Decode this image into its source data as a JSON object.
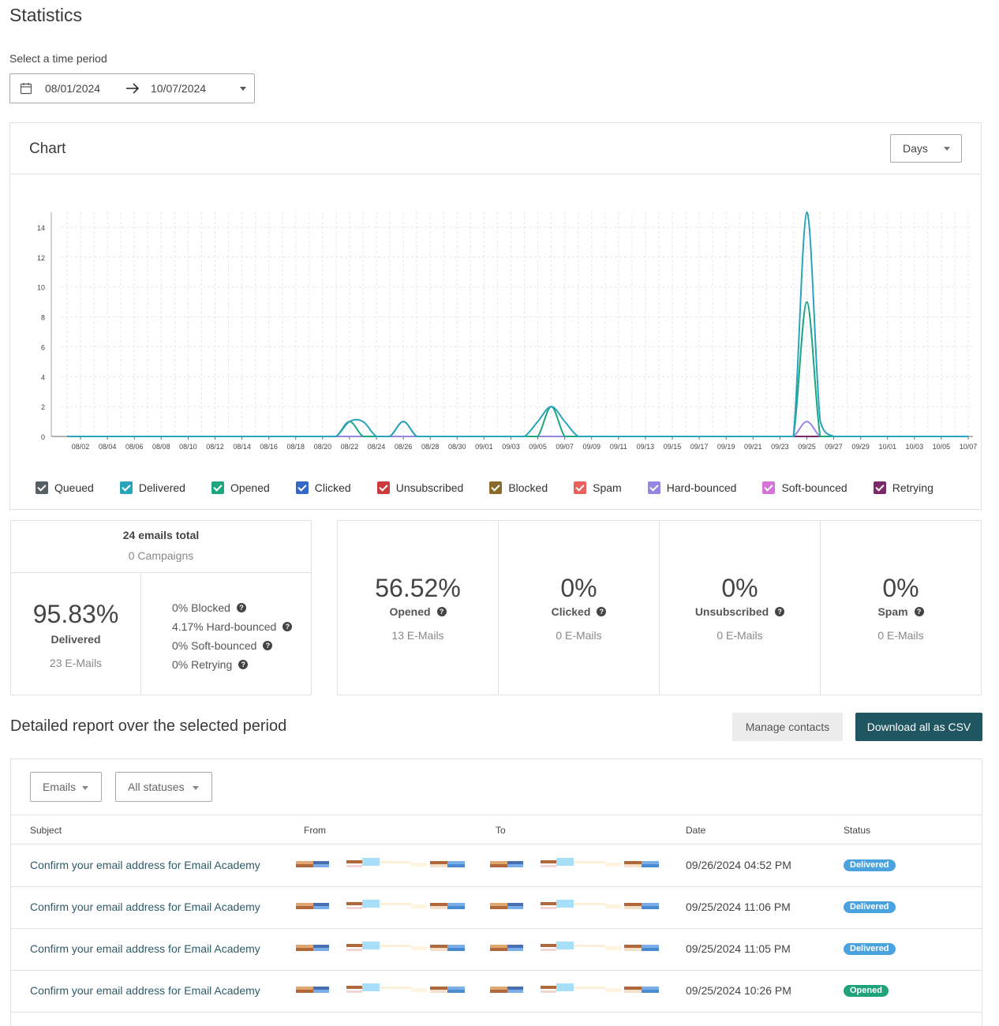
{
  "page": {
    "title": "Statistics"
  },
  "period": {
    "label": "Select a time period",
    "start": "08/01/2024",
    "end": "10/07/2024"
  },
  "chart_card": {
    "title": "Chart",
    "granularity": "Days"
  },
  "chart_data": {
    "type": "line",
    "x": [
      "08/01",
      "08/02",
      "08/03",
      "08/04",
      "08/05",
      "08/06",
      "08/07",
      "08/08",
      "08/09",
      "08/10",
      "08/11",
      "08/12",
      "08/13",
      "08/14",
      "08/15",
      "08/16",
      "08/17",
      "08/18",
      "08/19",
      "08/20",
      "08/21",
      "08/22",
      "08/23",
      "08/24",
      "08/25",
      "08/26",
      "08/27",
      "08/28",
      "08/29",
      "08/30",
      "08/31",
      "09/01",
      "09/02",
      "09/03",
      "09/04",
      "09/05",
      "09/06",
      "09/07",
      "09/08",
      "09/09",
      "09/10",
      "09/11",
      "09/12",
      "09/13",
      "09/14",
      "09/15",
      "09/16",
      "09/17",
      "09/18",
      "09/19",
      "09/20",
      "09/21",
      "09/22",
      "09/23",
      "09/24",
      "09/25",
      "09/26",
      "09/27",
      "09/28",
      "09/29",
      "09/30",
      "10/01",
      "10/02",
      "10/03",
      "10/04",
      "10/05",
      "10/06",
      "10/07"
    ],
    "tick_labels": [
      "08/02",
      "08/04",
      "08/06",
      "08/08",
      "08/10",
      "08/12",
      "08/14",
      "08/16",
      "08/18",
      "08/20",
      "08/22",
      "08/24",
      "08/26",
      "08/28",
      "08/30",
      "09/01",
      "09/03",
      "09/05",
      "09/07",
      "09/09",
      "09/11",
      "09/13",
      "09/15",
      "09/17",
      "09/19",
      "09/21",
      "09/23",
      "09/25",
      "09/27",
      "09/29",
      "10/01",
      "10/03",
      "10/05",
      "10/07"
    ],
    "y_ticks": [
      0,
      2,
      4,
      6,
      8,
      10,
      12,
      14
    ],
    "ylim": [
      0,
      15
    ],
    "grid": true,
    "legend_position": "bottom",
    "series": [
      {
        "name": "Queued",
        "color": "#555f66",
        "points": {}
      },
      {
        "name": "Delivered",
        "color": "#2aa3bd",
        "points": {
          "08/22": 1,
          "08/23": 1,
          "08/26": 1,
          "09/05": 1,
          "09/06": 2,
          "09/07": 1,
          "09/25": 15,
          "09/26": 1
        }
      },
      {
        "name": "Opened",
        "color": "#1ea680",
        "points": {
          "08/22": 1,
          "08/26": 1,
          "09/06": 2,
          "09/25": 9
        }
      },
      {
        "name": "Clicked",
        "color": "#3368c7",
        "points": {}
      },
      {
        "name": "Unsubscribed",
        "color": "#cc3b3b",
        "points": {}
      },
      {
        "name": "Blocked",
        "color": "#8a6a2a",
        "points": {}
      },
      {
        "name": "Spam",
        "color": "#eb5f5f",
        "points": {}
      },
      {
        "name": "Hard-bounced",
        "color": "#9586e3",
        "points": {
          "09/25": 1
        }
      },
      {
        "name": "Soft-bounced",
        "color": "#d574d6",
        "points": {}
      },
      {
        "name": "Retrying",
        "color": "#7a2a6b",
        "points": {}
      }
    ]
  },
  "summary": {
    "total": "24 emails total",
    "campaigns": "0 Campaigns",
    "delivered": {
      "pct": "95.83%",
      "label": "Delivered",
      "count": "23 E-Mails"
    },
    "breakdown": [
      "0% Blocked",
      "4.17% Hard-bounced",
      "0% Soft-bounced",
      "0% Retrying"
    ]
  },
  "stats": [
    {
      "pct": "56.52%",
      "label": "Opened",
      "count": "13 E-Mails"
    },
    {
      "pct": "0%",
      "label": "Clicked",
      "count": "0 E-Mails"
    },
    {
      "pct": "0%",
      "label": "Unsubscribed",
      "count": "0 E-Mails"
    },
    {
      "pct": "0%",
      "label": "Spam",
      "count": "0 E-Mails"
    }
  ],
  "report": {
    "title": "Detailed report over the selected period",
    "manage_label": "Manage contacts",
    "download_label": "Download all as CSV",
    "filter_type": "Emails",
    "filter_status": "All statuses",
    "columns": [
      "Subject",
      "From",
      "To",
      "Date",
      "Status"
    ],
    "rows": [
      {
        "subject": "Confirm your email address for Email Academy",
        "date": "09/26/2024 04:52 PM",
        "status": "Delivered",
        "status_color": "#4aa3df"
      },
      {
        "subject": "Confirm your email address for Email Academy",
        "date": "09/25/2024 11:06 PM",
        "status": "Delivered",
        "status_color": "#4aa3df"
      },
      {
        "subject": "Confirm your email address for Email Academy",
        "date": "09/25/2024 11:05 PM",
        "status": "Delivered",
        "status_color": "#4aa3df"
      },
      {
        "subject": "Confirm your email address for Email Academy",
        "date": "09/25/2024 10:26 PM",
        "status": "Opened",
        "status_color": "#1fa37a"
      }
    ]
  }
}
